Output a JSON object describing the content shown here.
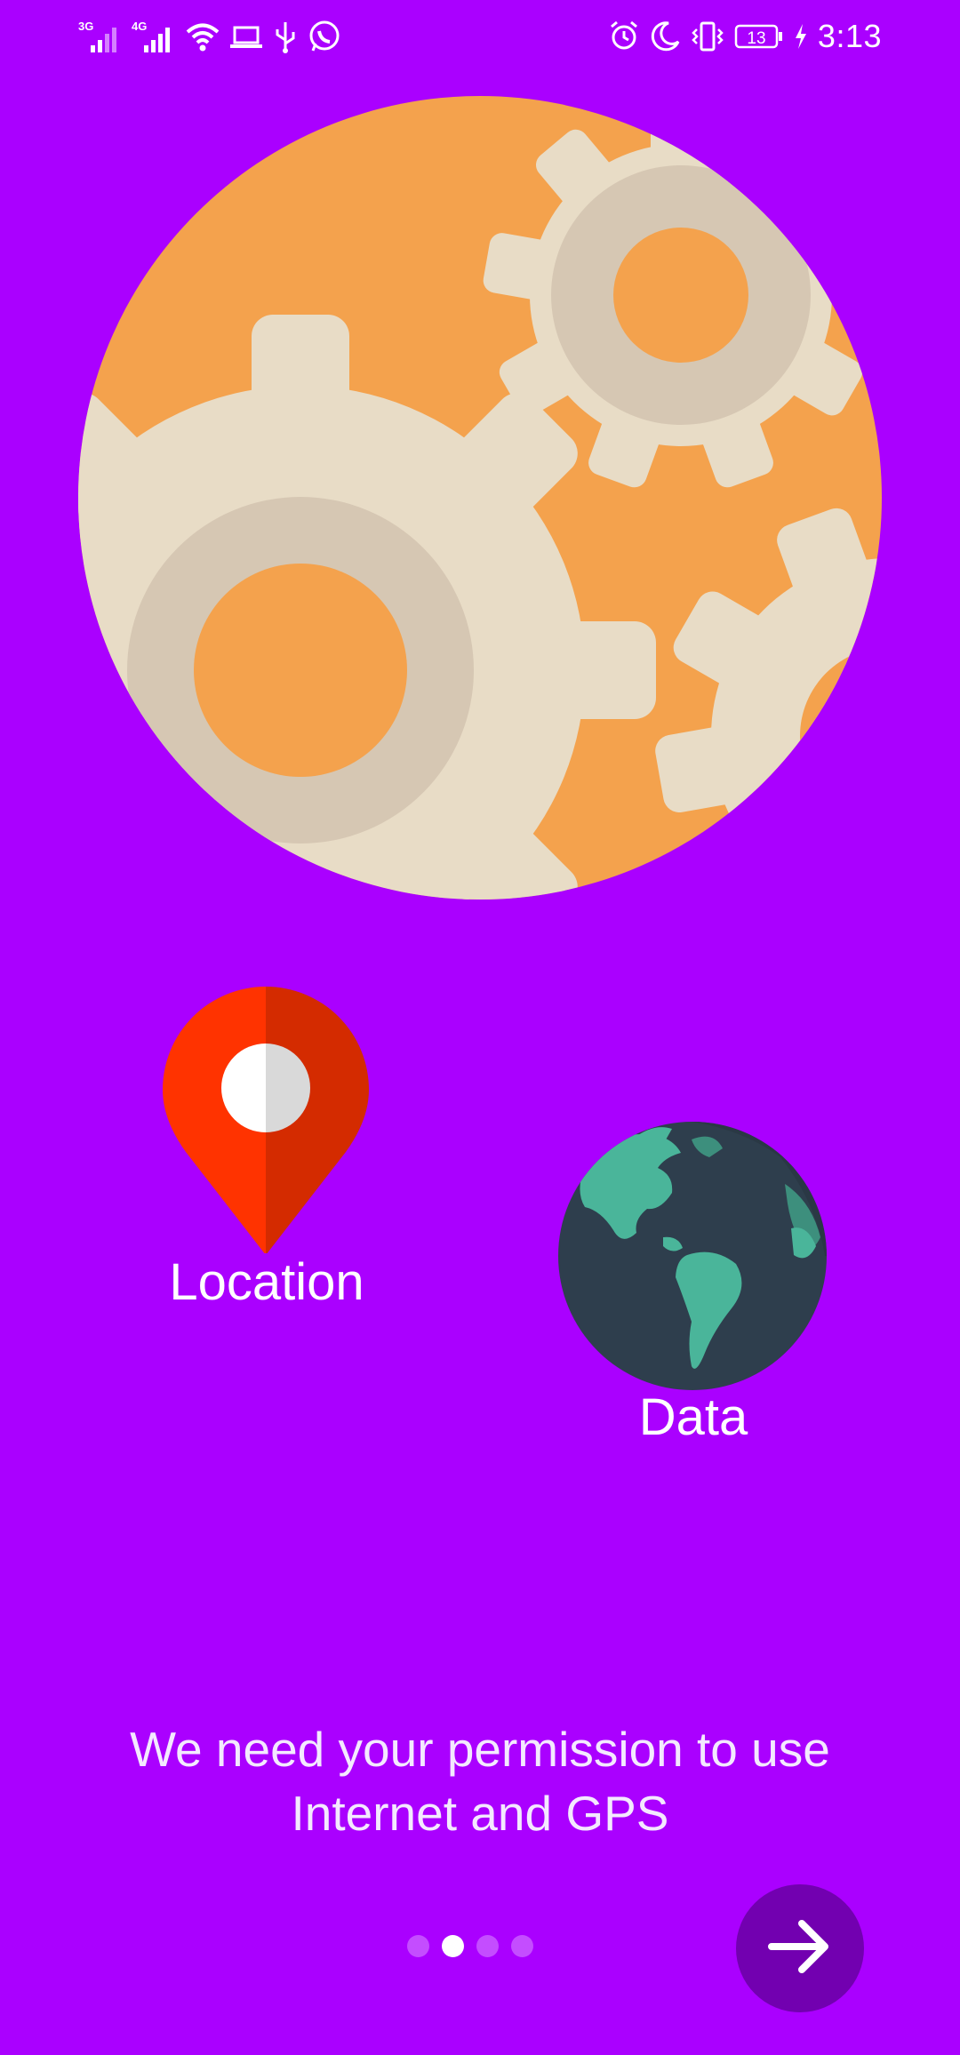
{
  "status_bar": {
    "left_icons": [
      "signal-3g-icon",
      "signal-4g-icon",
      "wifi-icon",
      "laptop-icon",
      "usb-icon",
      "whatsapp-icon"
    ],
    "signal_labels": [
      "3G",
      "4G"
    ],
    "right_icons": [
      "alarm-icon",
      "moon-icon",
      "vibrate-icon",
      "battery-icon",
      "charging-icon"
    ],
    "battery_level": "13",
    "time": "3:13"
  },
  "hero": {
    "illustration": "gears-circle-illustration"
  },
  "permissions": {
    "location": {
      "label": "Location",
      "icon": "location-pin-icon"
    },
    "data": {
      "label": "Data",
      "icon": "globe-icon"
    }
  },
  "message": {
    "line1": "We need your permission to use",
    "line2": "Internet and GPS"
  },
  "pager": {
    "total": 4,
    "active_index": 1
  },
  "next_button": {
    "icon": "arrow-right-icon"
  },
  "colors": {
    "background": "#aa00ff",
    "next_button": "#7200b0",
    "gear_orange": "#f4a24d",
    "gear_cream": "#e8dcc6",
    "pin_red": "#ff3300",
    "globe_dark": "#2e3e4d",
    "globe_green": "#4ab59a"
  }
}
